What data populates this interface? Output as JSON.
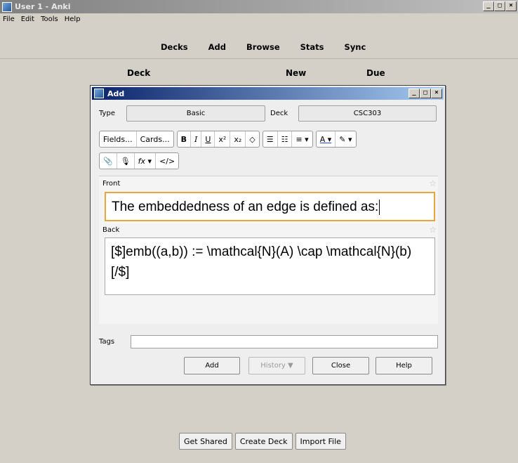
{
  "main_window": {
    "title": "User 1 - Anki",
    "menu": [
      "File",
      "Edit",
      "Tools",
      "Help"
    ],
    "toplinks": [
      "Decks",
      "Add",
      "Browse",
      "Stats",
      "Sync"
    ],
    "deck_headers": {
      "deck": "Deck",
      "new": "New",
      "due": "Due"
    },
    "bottom_buttons": [
      "Get Shared",
      "Create Deck",
      "Import File"
    ],
    "window_buttons": {
      "minimize": "_",
      "maximize": "□",
      "close": "×"
    }
  },
  "add_dialog": {
    "title": "Add",
    "type_label": "Type",
    "type_value": "Basic",
    "deck_label": "Deck",
    "deck_value": "CSC303",
    "toolbar": {
      "fields": "Fields...",
      "cards": "Cards...",
      "bold": "B",
      "italic": "I",
      "underline": "U",
      "superscript": "x²",
      "subscript": "x₂",
      "clear_format": "◇",
      "unordered_list": "☰",
      "ordered_list": "☷",
      "align": "≡ ▾",
      "text_color": "A ▾",
      "highlight": "✎ ▾",
      "attach": "📎",
      "record": "🎙",
      "formula": "fx ▾",
      "html": "</>"
    },
    "front_label": "Front",
    "front_value": "The embeddedness of an edge is defined as:",
    "back_label": "Back",
    "back_value": "[$]emb((a,b)) := \\mathcal{N}(A) \\cap \\mathcal{N}(b)[/$]",
    "tags_label": "Tags",
    "tags_value": "",
    "buttons": {
      "add": "Add",
      "history": "History ▼",
      "close": "Close",
      "help": "Help"
    }
  }
}
